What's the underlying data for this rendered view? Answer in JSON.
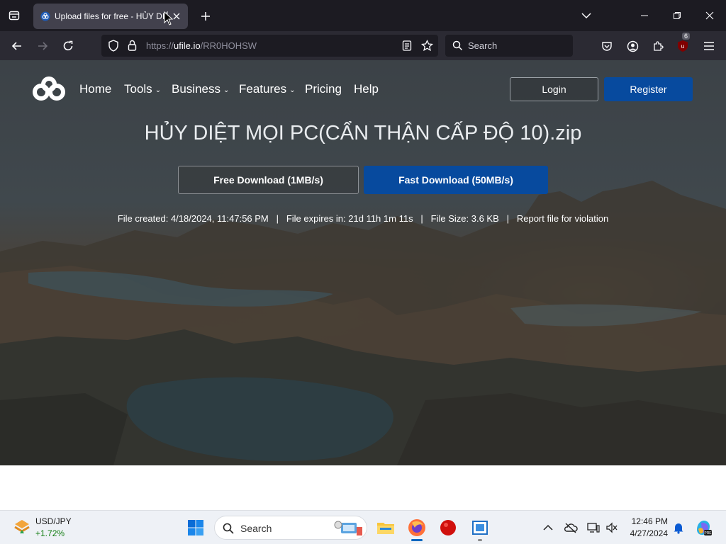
{
  "browser": {
    "tab": {
      "title": "Upload files for free - HỦY DIỆT"
    },
    "url": {
      "prefix": "https://",
      "host": "ufile.io",
      "path": "/RR0HOHSW"
    },
    "search_placeholder": "Search",
    "extension_badge": "6"
  },
  "site": {
    "nav": [
      {
        "label": "Home"
      },
      {
        "label": "Tools"
      },
      {
        "label": "Business"
      },
      {
        "label": "Features"
      },
      {
        "label": "Pricing"
      },
      {
        "label": "Help"
      }
    ],
    "login_label": "Login",
    "register_label": "Register",
    "file_name": "HỦY DIỆT MỌI PC(CẨN THẬN CẤP ĐỘ 10).zip",
    "free_download_label": "Free Download (1MB/s)",
    "fast_download_label": "Fast Download (50MB/s)",
    "meta": {
      "created": "File created: 4/18/2024, 11:47:56 PM",
      "expires": "File expires in: 21d 11h 1m 11s",
      "size": "File Size: 3.6 KB",
      "report": "Report file for violation",
      "separator": "|"
    },
    "colors": {
      "accent": "#074a9e"
    }
  },
  "taskbar": {
    "widget": {
      "symbol": "USD/JPY",
      "change": "+1.72%"
    },
    "search_placeholder": "Search",
    "time": "12:46 PM",
    "date": "4/27/2024"
  }
}
